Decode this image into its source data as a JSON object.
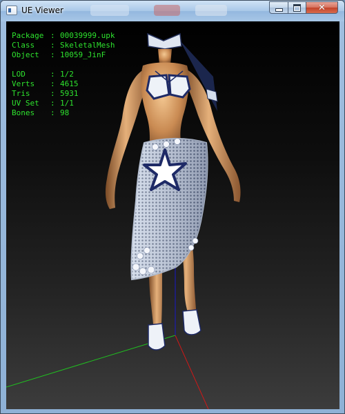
{
  "window": {
    "title": "UE Viewer",
    "close_glyph": "✕"
  },
  "info": {
    "separator": ":",
    "package": {
      "label": "Package",
      "value": "00039999.upk"
    },
    "class": {
      "label": "Class",
      "value": "SkeletalMesh"
    },
    "object": {
      "label": "Object",
      "value": "10059_JinF"
    },
    "lod": {
      "label": "LOD",
      "value": "1/2"
    },
    "verts": {
      "label": "Verts",
      "value": "4615"
    },
    "tris": {
      "label": "Tris",
      "value": "5931"
    },
    "uv_set": {
      "label": "UV Set",
      "value": "1/1"
    },
    "bones": {
      "label": "Bones",
      "value": "98"
    }
  },
  "colors": {
    "info_text": "#2ee32e",
    "axis_x": "#d01818",
    "axis_y": "#20c020",
    "axis_z": "#1818c8"
  },
  "icons": {
    "app": "ue-viewer-app-icon",
    "minimize": "minimize-icon",
    "maximize": "maximize-icon",
    "close": "close-icon"
  }
}
